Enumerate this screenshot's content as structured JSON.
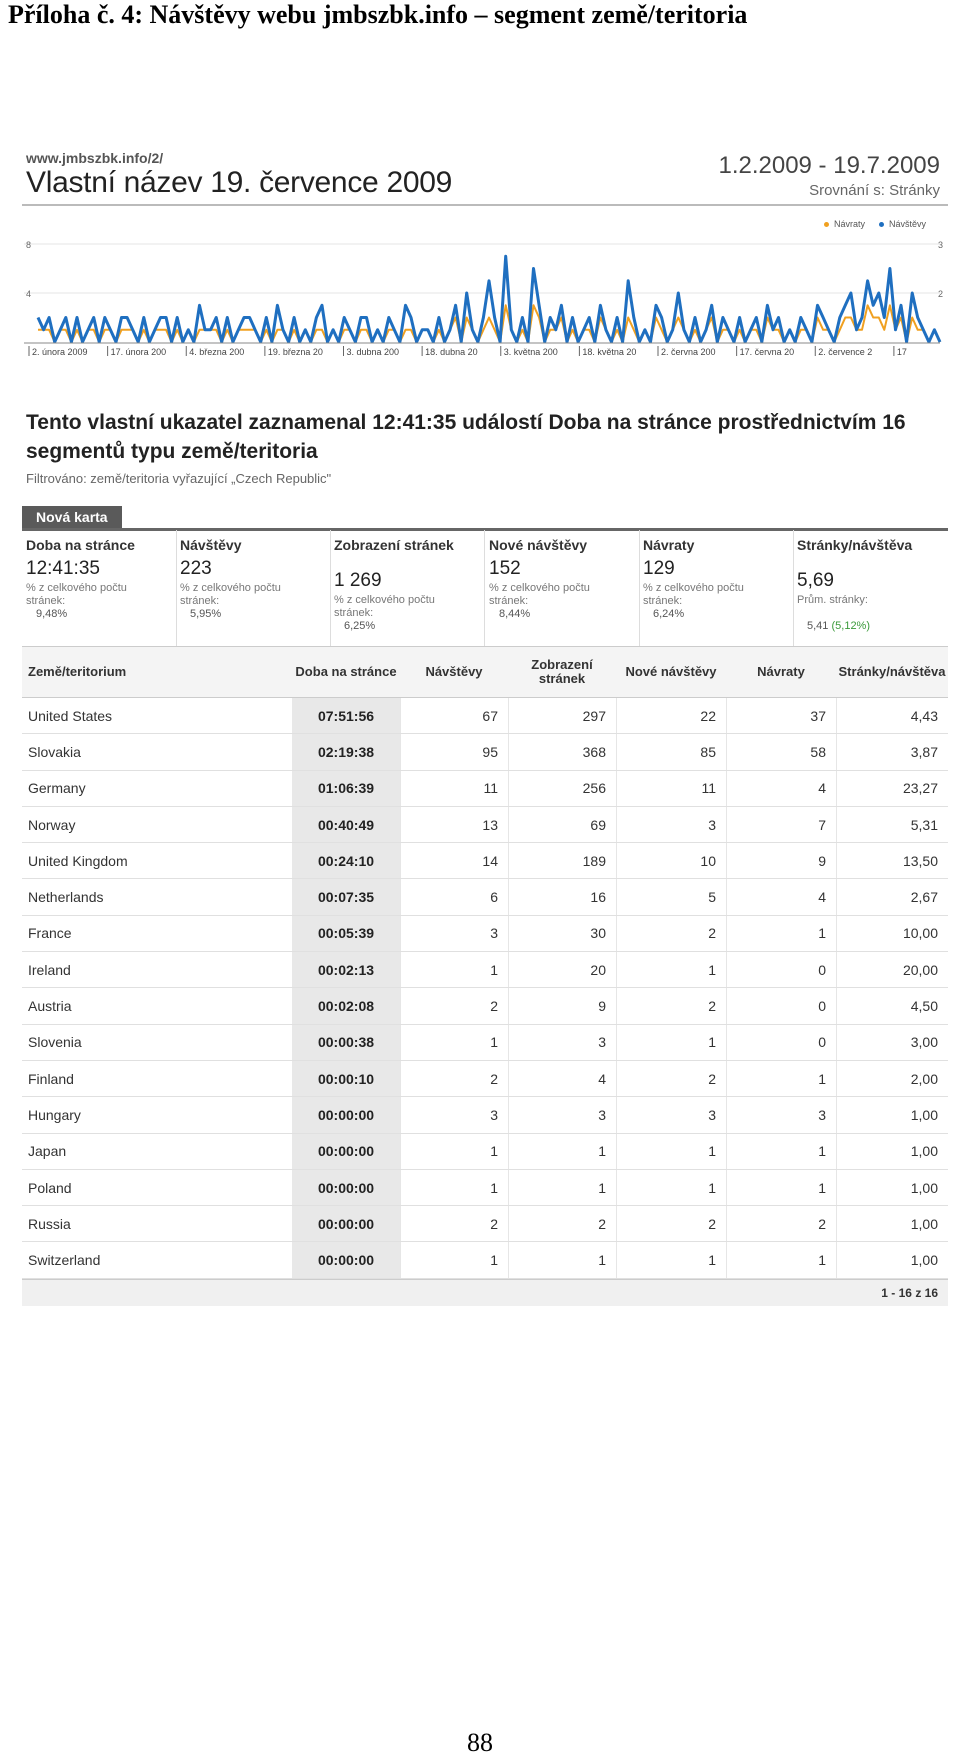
{
  "document": {
    "title": "Příloha č. 4: Návštěvy webu jmbszbk.info – segment země/teritoria",
    "page_number": "88"
  },
  "report": {
    "url": "www.jmbszbk.info/2/",
    "name": "Vlastní název 19. července 2009",
    "date_range": "1.2.2009 - 19.7.2009",
    "compare": "Srovnání s: Stránky",
    "legend": {
      "returns": "Návraty",
      "visits": "Návštěvy"
    },
    "colors": {
      "returns": "#f0a020",
      "visits": "#1f6fc0"
    }
  },
  "chart_data": {
    "type": "line",
    "title": "",
    "y_left_ticks": [
      "8",
      "4"
    ],
    "y_right_ticks": [
      "3",
      "2"
    ],
    "x_tick_labels": [
      "2. února 2009",
      "17. února 200",
      "4. března 200",
      "19. března 20",
      "3. dubna 200",
      "18. dubna 20",
      "3. května 200",
      "18. května 20",
      "2. června 200",
      "17. června 20",
      "2. července 2",
      "17"
    ],
    "series": [
      {
        "name": "Návštěvy",
        "values": [
          2,
          1,
          2,
          0,
          1,
          2,
          0,
          2,
          0,
          1,
          2,
          0,
          2,
          1,
          0,
          2,
          2,
          1,
          0,
          2,
          0,
          1,
          2,
          2,
          0,
          2,
          0,
          1,
          0,
          3,
          1,
          1,
          2,
          0,
          2,
          0,
          1,
          2,
          2,
          1,
          0,
          2,
          0,
          3,
          1,
          0,
          2,
          0,
          1,
          0,
          2,
          3,
          0,
          1,
          0,
          2,
          1,
          0,
          2,
          2,
          0,
          1,
          0,
          2,
          1,
          0,
          3,
          2,
          0,
          1,
          1,
          0,
          2,
          0,
          1,
          3,
          0,
          4,
          1,
          0,
          2,
          5,
          2,
          0,
          7,
          1,
          0,
          2,
          0,
          6,
          3,
          0,
          2,
          1,
          3,
          0,
          2,
          0,
          1,
          2,
          0,
          3,
          1,
          0,
          2,
          0,
          5,
          2,
          0,
          1,
          0,
          3,
          2,
          0,
          1,
          4,
          1,
          0,
          2,
          0,
          1,
          3,
          0,
          2,
          1,
          0,
          2,
          0,
          1,
          2,
          0,
          3,
          1,
          2,
          0,
          1,
          0,
          2,
          1,
          0,
          3,
          2,
          1,
          0,
          2,
          3,
          4,
          1,
          2,
          5,
          3,
          4,
          2,
          6,
          1,
          3,
          0,
          4,
          2,
          1,
          0,
          1,
          0
        ]
      },
      {
        "name": "Návraty",
        "values": [
          1,
          1,
          1,
          0,
          1,
          1,
          0,
          1,
          0,
          1,
          1,
          0,
          1,
          1,
          0,
          1,
          1,
          1,
          0,
          1,
          0,
          1,
          1,
          1,
          0,
          1,
          0,
          1,
          0,
          1,
          1,
          1,
          1,
          0,
          1,
          0,
          1,
          1,
          1,
          1,
          0,
          1,
          0,
          1,
          1,
          0,
          1,
          0,
          1,
          0,
          1,
          1,
          0,
          1,
          0,
          1,
          1,
          0,
          1,
          1,
          0,
          1,
          0,
          1,
          1,
          0,
          1,
          1,
          0,
          1,
          1,
          0,
          1,
          0,
          1,
          2,
          0,
          2,
          1,
          0,
          1,
          2,
          1,
          0,
          3,
          1,
          0,
          1,
          0,
          3,
          2,
          0,
          1,
          1,
          2,
          0,
          1,
          0,
          1,
          1,
          0,
          2,
          1,
          0,
          1,
          0,
          2,
          1,
          0,
          1,
          0,
          2,
          1,
          0,
          1,
          2,
          1,
          0,
          1,
          0,
          1,
          2,
          0,
          1,
          1,
          0,
          1,
          0,
          1,
          1,
          0,
          2,
          1,
          1,
          0,
          1,
          0,
          1,
          1,
          0,
          2,
          1,
          1,
          0,
          1,
          2,
          2,
          1,
          1,
          3,
          2,
          2,
          1,
          3,
          1,
          2,
          0,
          2,
          1,
          1,
          0,
          1,
          0
        ]
      }
    ]
  },
  "summary": {
    "heading": "Tento vlastní ukazatel zaznamenal 12:41:35 událostí Doba na stránce prostřednictvím 16 segmentů typu země/teritoria",
    "filter": "Filtrováno: země/teritoria vyřazující „Czech Republic\""
  },
  "tab": {
    "label": "Nová karta"
  },
  "metrics": [
    {
      "label": "Doba na stránce",
      "value": "12:41:35",
      "note": "% z celkového počtu stránek:",
      "pct": "9,48%"
    },
    {
      "label": "Návštěvy",
      "value": "223",
      "note": "% z celkového počtu stránek:",
      "pct": "5,95%"
    },
    {
      "label": "Zobrazení stránek",
      "value": "1 269",
      "note": "% z celkového počtu stránek:",
      "pct": "6,25%"
    },
    {
      "label": "Nové návštěvy",
      "value": "152",
      "note": "% z celkového počtu stránek:",
      "pct": "8,44%"
    },
    {
      "label": "Návraty",
      "value": "129",
      "note": "% z celkového počtu stránek:",
      "pct": "6,24%"
    },
    {
      "label": "Stránky/návštěva",
      "value": "5,69",
      "note": "Prům. stránky:",
      "pct": "5,41",
      "pct_extra": "(5,12%)"
    }
  ],
  "table": {
    "headers": {
      "country": "Země/teritorium",
      "time": "Doba na stránce",
      "visits": "Návštěvy",
      "pageviews": "Zobrazení stránek",
      "new_visits": "Nové návštěvy",
      "returns": "Návraty",
      "pages_per_visit": "Stránky/návštěva"
    },
    "rows": [
      {
        "country": "United States",
        "time": "07:51:56",
        "visits": "67",
        "pageviews": "297",
        "new_visits": "22",
        "returns": "37",
        "ppv": "4,43"
      },
      {
        "country": "Slovakia",
        "time": "02:19:38",
        "visits": "95",
        "pageviews": "368",
        "new_visits": "85",
        "returns": "58",
        "ppv": "3,87"
      },
      {
        "country": "Germany",
        "time": "01:06:39",
        "visits": "11",
        "pageviews": "256",
        "new_visits": "11",
        "returns": "4",
        "ppv": "23,27"
      },
      {
        "country": "Norway",
        "time": "00:40:49",
        "visits": "13",
        "pageviews": "69",
        "new_visits": "3",
        "returns": "7",
        "ppv": "5,31"
      },
      {
        "country": "United Kingdom",
        "time": "00:24:10",
        "visits": "14",
        "pageviews": "189",
        "new_visits": "10",
        "returns": "9",
        "ppv": "13,50"
      },
      {
        "country": "Netherlands",
        "time": "00:07:35",
        "visits": "6",
        "pageviews": "16",
        "new_visits": "5",
        "returns": "4",
        "ppv": "2,67"
      },
      {
        "country": "France",
        "time": "00:05:39",
        "visits": "3",
        "pageviews": "30",
        "new_visits": "2",
        "returns": "1",
        "ppv": "10,00"
      },
      {
        "country": "Ireland",
        "time": "00:02:13",
        "visits": "1",
        "pageviews": "20",
        "new_visits": "1",
        "returns": "0",
        "ppv": "20,00"
      },
      {
        "country": "Austria",
        "time": "00:02:08",
        "visits": "2",
        "pageviews": "9",
        "new_visits": "2",
        "returns": "0",
        "ppv": "4,50"
      },
      {
        "country": "Slovenia",
        "time": "00:00:38",
        "visits": "1",
        "pageviews": "3",
        "new_visits": "1",
        "returns": "0",
        "ppv": "3,00"
      },
      {
        "country": "Finland",
        "time": "00:00:10",
        "visits": "2",
        "pageviews": "4",
        "new_visits": "2",
        "returns": "1",
        "ppv": "2,00"
      },
      {
        "country": "Hungary",
        "time": "00:00:00",
        "visits": "3",
        "pageviews": "3",
        "new_visits": "3",
        "returns": "3",
        "ppv": "1,00"
      },
      {
        "country": "Japan",
        "time": "00:00:00",
        "visits": "1",
        "pageviews": "1",
        "new_visits": "1",
        "returns": "1",
        "ppv": "1,00"
      },
      {
        "country": "Poland",
        "time": "00:00:00",
        "visits": "1",
        "pageviews": "1",
        "new_visits": "1",
        "returns": "1",
        "ppv": "1,00"
      },
      {
        "country": "Russia",
        "time": "00:00:00",
        "visits": "2",
        "pageviews": "2",
        "new_visits": "2",
        "returns": "2",
        "ppv": "1,00"
      },
      {
        "country": "Switzerland",
        "time": "00:00:00",
        "visits": "1",
        "pageviews": "1",
        "new_visits": "1",
        "returns": "1",
        "ppv": "1,00"
      }
    ],
    "pager": "1 - 16 z 16"
  }
}
